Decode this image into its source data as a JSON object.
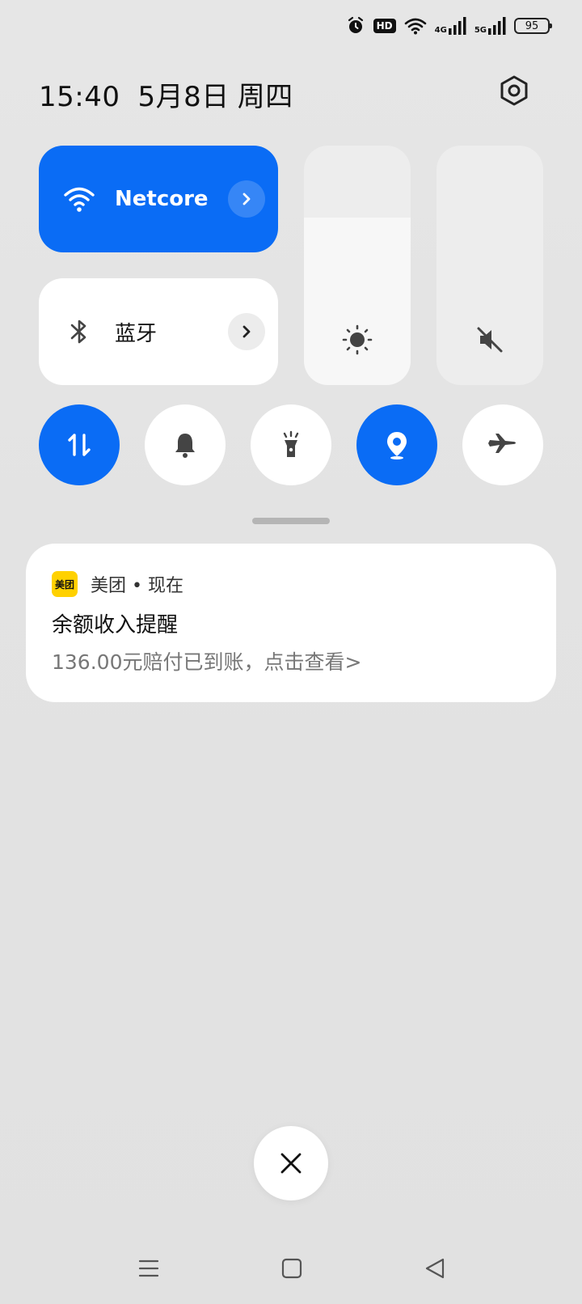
{
  "status_bar": {
    "hd_label": "HD",
    "network_4g": "4G",
    "network_5g": "5G",
    "battery_level": "95",
    "icons": [
      "alarm-icon",
      "hd-voice-icon",
      "wifi-icon",
      "signal-4g-icon",
      "signal-5g-icon",
      "battery-icon"
    ]
  },
  "header": {
    "time": "15:40",
    "date": "5月8日",
    "weekday": "周四",
    "settings_icon": "gear-icon"
  },
  "quick_tiles": {
    "wifi": {
      "label": "Netcore",
      "icon": "wifi-icon",
      "color": "#0a6cf5"
    },
    "bluetooth": {
      "label": "蓝牙",
      "icon": "bluetooth-icon"
    }
  },
  "sliders": {
    "brightness": {
      "level": 0.7,
      "icon": "brightness-icon"
    },
    "volume": {
      "level": 0.0,
      "icon": "mute-icon"
    }
  },
  "toggles": [
    {
      "name": "mobile-data",
      "icon": "data-transfer-icon",
      "active": true
    },
    {
      "name": "sound",
      "icon": "bell-icon",
      "active": false
    },
    {
      "name": "flashlight",
      "icon": "flashlight-icon",
      "active": false
    },
    {
      "name": "location",
      "icon": "location-icon",
      "active": true
    },
    {
      "name": "airplane-mode",
      "icon": "airplane-icon",
      "active": false
    }
  ],
  "notification": {
    "app_icon_text": "美团",
    "app_header": "美团 • 现在",
    "title": "余额收入提醒",
    "body": "136.00元赔付已到账，点击查看>"
  },
  "nav": {
    "icons": [
      "menu-icon",
      "home-icon",
      "back-icon"
    ]
  },
  "colors": {
    "accent": "#0a6cf5",
    "meituan_yellow": "#ffd100"
  }
}
